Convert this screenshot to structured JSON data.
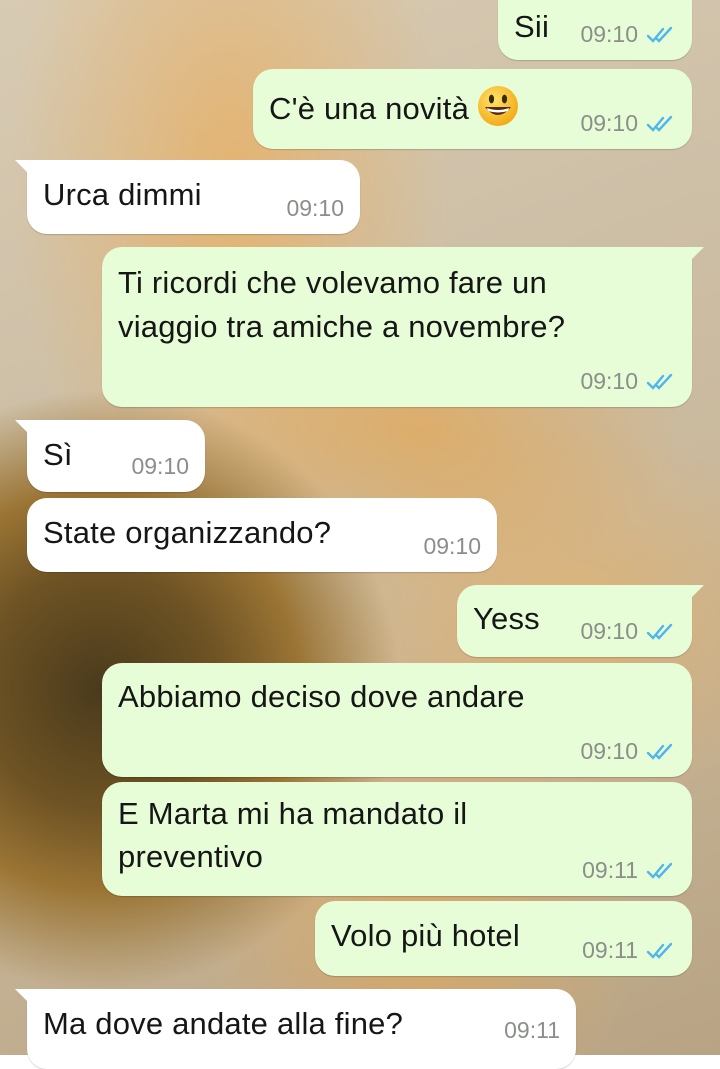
{
  "messages": [
    {
      "id": "m1",
      "dir": "out",
      "text": "Sii",
      "time": "09:10",
      "status": "read"
    },
    {
      "id": "m2",
      "dir": "out",
      "text": "C'è una novità",
      "emoji": "grinning-face-emoji",
      "time": "09:10",
      "status": "read"
    },
    {
      "id": "m3",
      "dir": "in",
      "text": "Urca dimmi",
      "time": "09:10"
    },
    {
      "id": "m4",
      "dir": "out",
      "lines": [
        "Ti ricordi che volevamo fare un",
        "viaggio tra amiche a novembre?"
      ],
      "time": "09:10",
      "status": "read"
    },
    {
      "id": "m5",
      "dir": "in",
      "text": "Sì",
      "time": "09:10"
    },
    {
      "id": "m6",
      "dir": "in",
      "text": "State organizzando?",
      "time": "09:10"
    },
    {
      "id": "m7",
      "dir": "out",
      "text": "Yess",
      "time": "09:10",
      "status": "read"
    },
    {
      "id": "m8",
      "dir": "out",
      "text": "Abbiamo deciso dove andare",
      "time": "09:10",
      "status": "read"
    },
    {
      "id": "m9",
      "dir": "out",
      "lines": [
        "E Marta mi ha mandato il",
        "preventivo"
      ],
      "time": "09:11",
      "status": "read"
    },
    {
      "id": "m10",
      "dir": "out",
      "text": "Volo più hotel",
      "time": "09:11",
      "status": "read"
    },
    {
      "id": "m11",
      "dir": "in",
      "text": "Ma dove andate alla fine?",
      "time": "09:11"
    }
  ],
  "colors": {
    "outgoing_bubble": "#e7fdd8",
    "incoming_bubble": "#ffffff",
    "read_tick": "#4fb6ec",
    "timestamp": "#8a8f89"
  }
}
